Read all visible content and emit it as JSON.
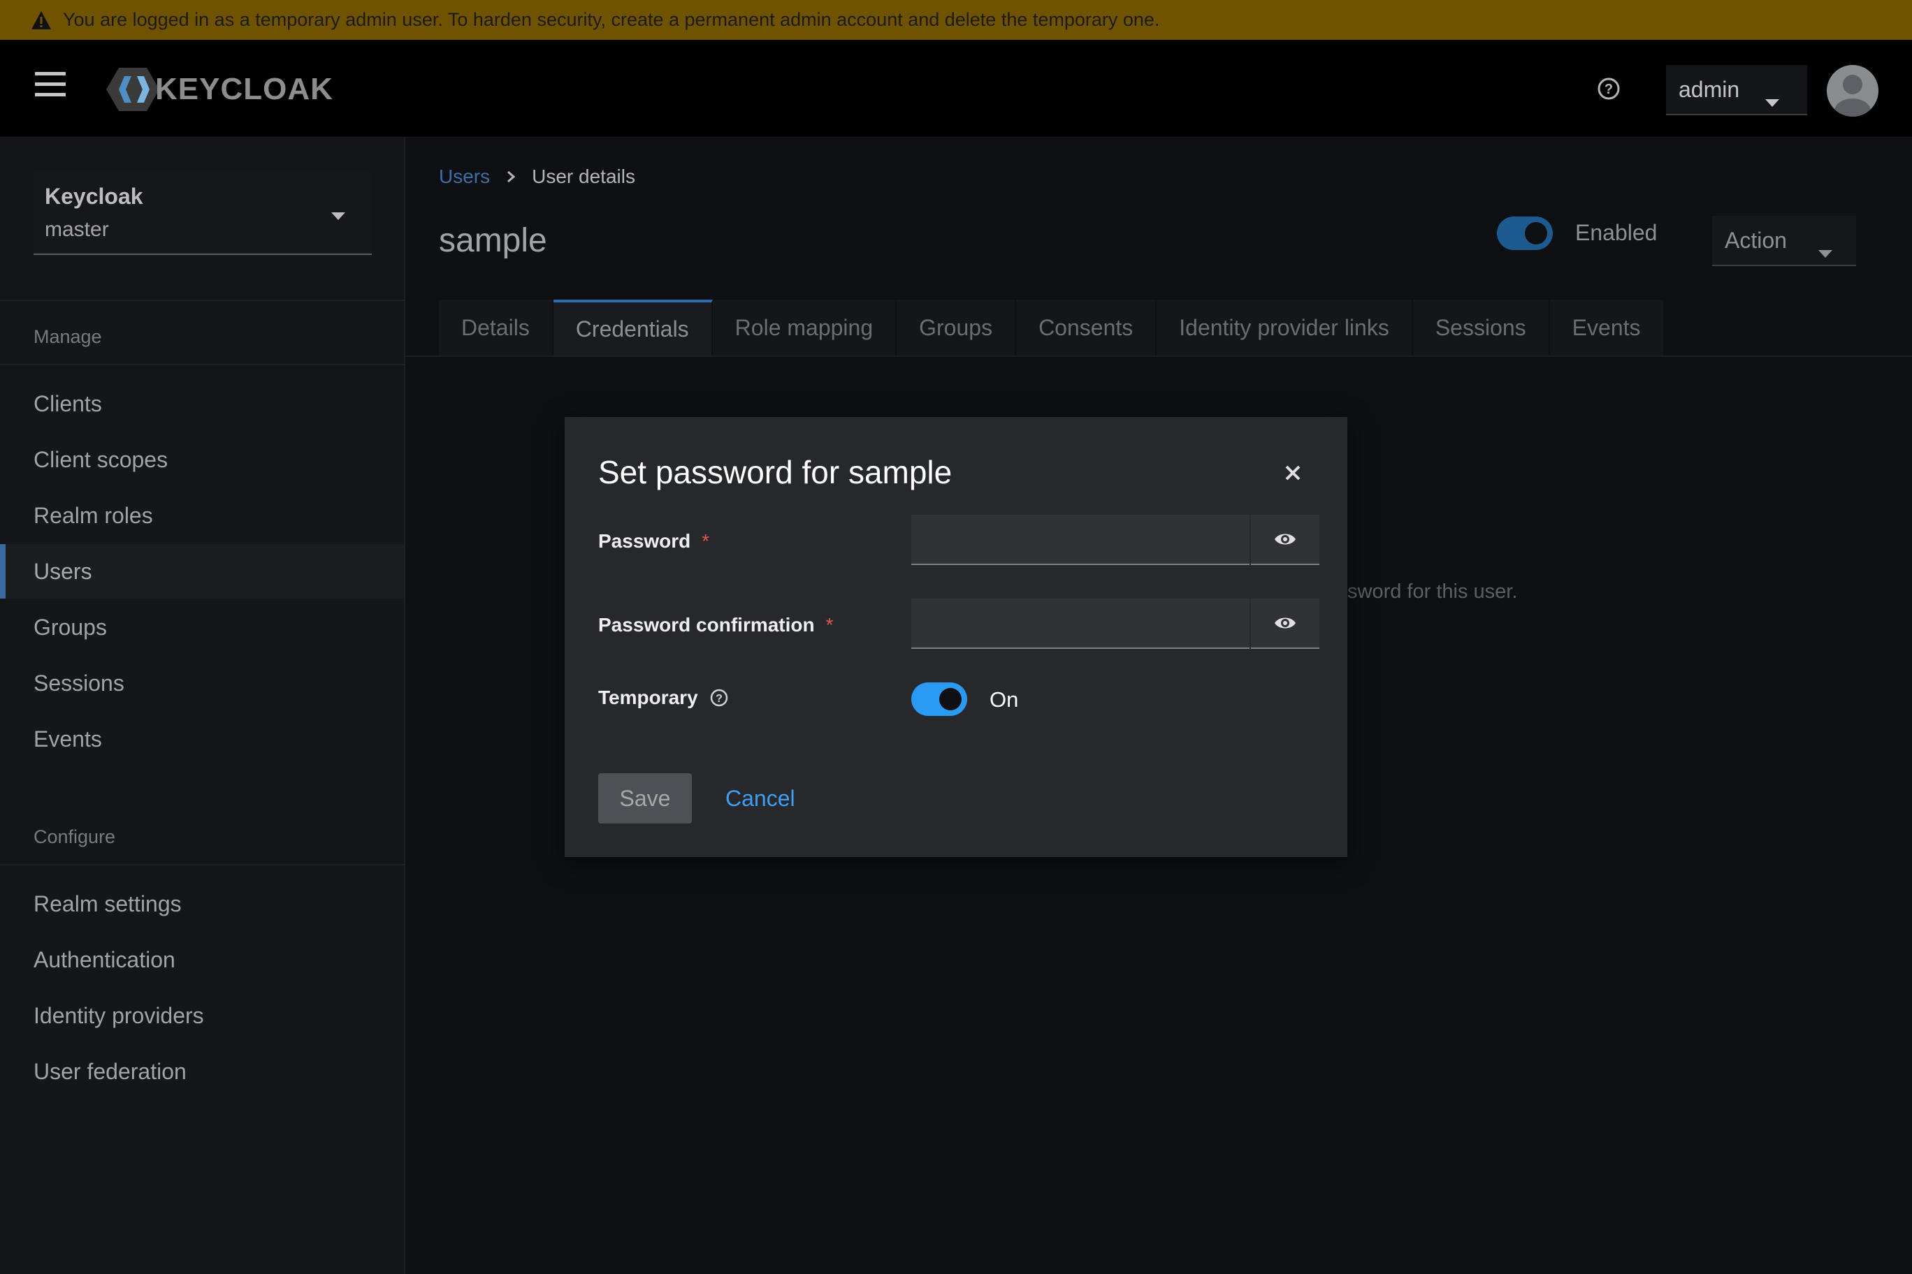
{
  "banner": {
    "message": "You are logged in as a temporary admin user. To harden security, create a permanent admin account and delete the temporary one.",
    "icon": "warning-icon",
    "color": "#6f5300"
  },
  "masthead": {
    "logo_text": "KEYCLOAK",
    "user_menu_label": "admin",
    "help_icon": "help-circle-icon"
  },
  "sidebar": {
    "realm": {
      "name": "Keycloak",
      "value": "master"
    },
    "manage_heading": "Manage",
    "manage_items": [
      {
        "label": "Clients"
      },
      {
        "label": "Client scopes"
      },
      {
        "label": "Realm roles"
      },
      {
        "label": "Users"
      },
      {
        "label": "Groups"
      },
      {
        "label": "Sessions"
      },
      {
        "label": "Events"
      }
    ],
    "configure_heading": "Configure",
    "configure_items": [
      {
        "label": "Realm settings"
      },
      {
        "label": "Authentication"
      },
      {
        "label": "Identity providers"
      },
      {
        "label": "User federation"
      }
    ],
    "active_item": "Users"
  },
  "main": {
    "breadcrumb": {
      "parent": "Users",
      "current": "User details"
    },
    "title": "sample",
    "enabled_label": "Enabled",
    "action_label": "Action",
    "tabs": [
      {
        "label": "Details"
      },
      {
        "label": "Credentials"
      },
      {
        "label": "Role mapping"
      },
      {
        "label": "Groups"
      },
      {
        "label": "Consents"
      },
      {
        "label": "Identity provider links"
      },
      {
        "label": "Sessions"
      },
      {
        "label": "Events"
      }
    ],
    "active_tab": "Credentials",
    "empty_state_fragment": "sword for this user."
  },
  "modal": {
    "title": "Set password for sample",
    "password_label": "Password",
    "password_value": "",
    "confirm_label": "Password confirmation",
    "confirm_value": "",
    "required_mark": "*",
    "temporary_label": "Temporary",
    "temporary_state": "On",
    "save_label": "Save",
    "cancel_label": "Cancel"
  },
  "colors": {
    "accent": "#2b9af3",
    "link": "#3ea0f5",
    "required": "#e05a4f"
  }
}
